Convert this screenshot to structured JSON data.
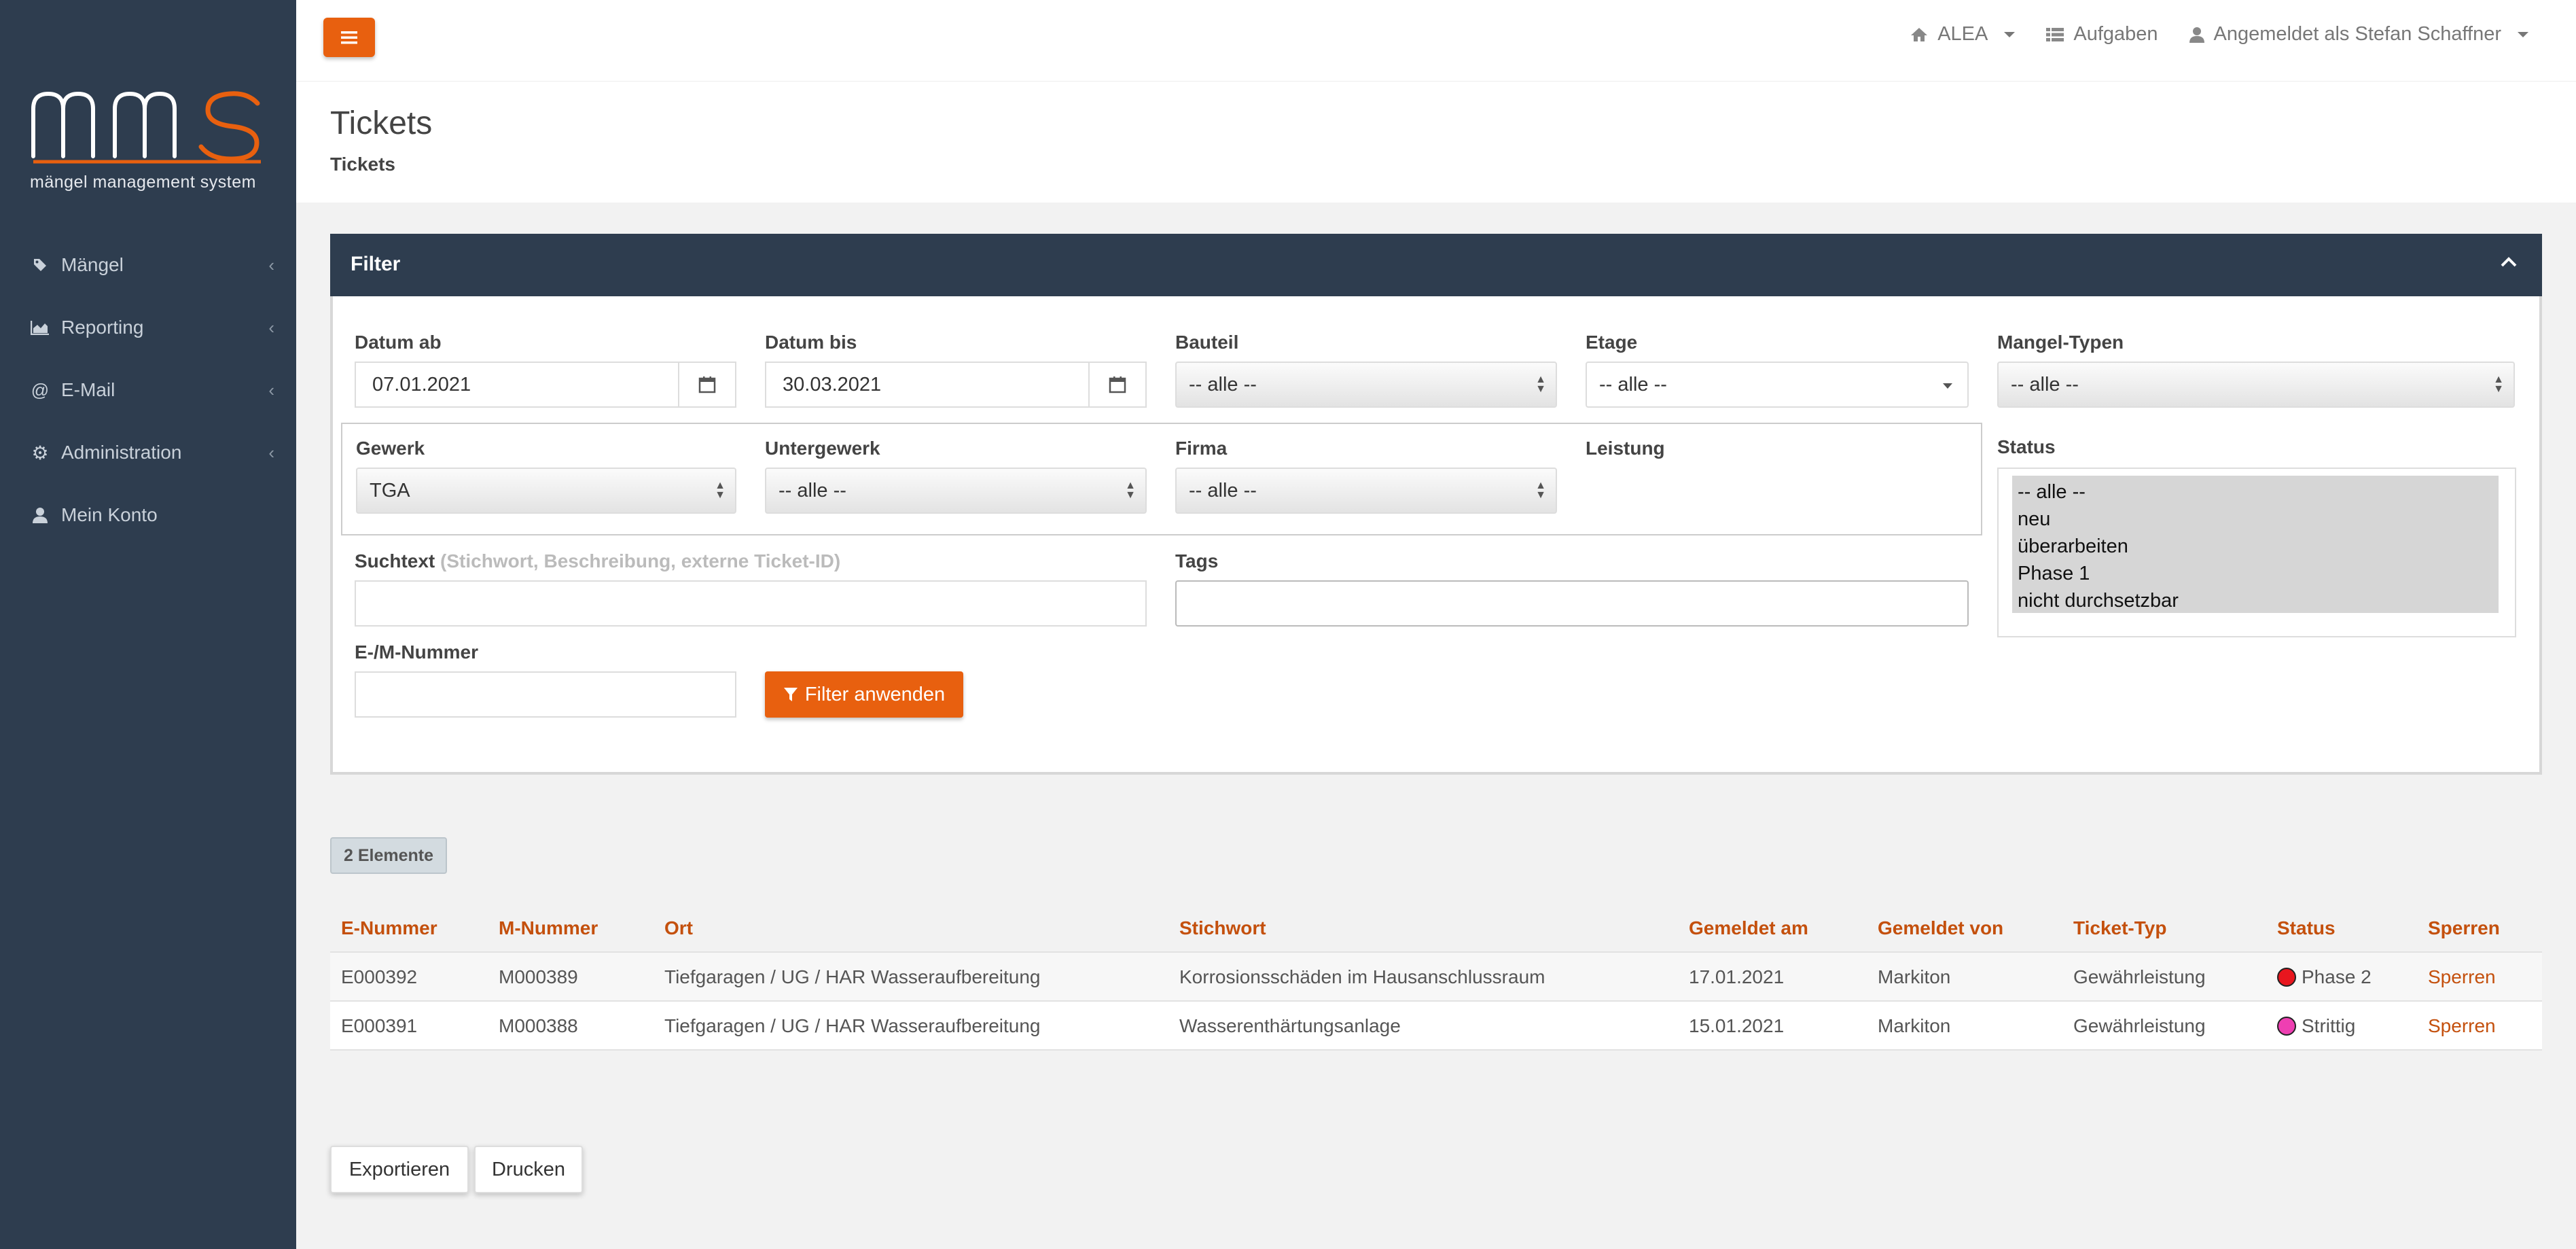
{
  "colors": {
    "accent": "#e8600f",
    "sidebar": "#2e3d4f",
    "header_link": "#c4500d"
  },
  "brand": {
    "subtitle": "mängel management system"
  },
  "sidebar": {
    "items": [
      {
        "label": "Mängel",
        "icon": "tag-icon"
      },
      {
        "label": "Reporting",
        "icon": "area-chart-icon"
      },
      {
        "label": "E-Mail",
        "icon": "at-icon"
      },
      {
        "label": "Administration",
        "icon": "gear-icon"
      },
      {
        "label": "Mein Konto",
        "icon": "user-icon"
      }
    ]
  },
  "topbar": {
    "project": "ALEA",
    "tasks": "Aufgaben",
    "user": "Angemeldet als Stefan Schaffner"
  },
  "page": {
    "title": "Tickets",
    "breadcrumb": "Tickets"
  },
  "filter": {
    "title": "Filter",
    "datum_ab": {
      "label": "Datum ab",
      "value": "07.01.2021"
    },
    "datum_bis": {
      "label": "Datum bis",
      "value": "30.03.2021"
    },
    "bauteil": {
      "label": "Bauteil",
      "value": "-- alle --"
    },
    "etage": {
      "label": "Etage",
      "value": "-- alle --"
    },
    "mangel_typen": {
      "label": "Mangel-Typen",
      "value": "-- alle --"
    },
    "gewerk": {
      "label": "Gewerk",
      "value": "TGA"
    },
    "untergewerk": {
      "label": "Untergewerk",
      "value": "-- alle --"
    },
    "firma": {
      "label": "Firma",
      "value": "-- alle --"
    },
    "leistung": {
      "label": "Leistung"
    },
    "status": {
      "label": "Status",
      "options": [
        "-- alle --",
        "neu",
        "überarbeiten",
        "Phase 1",
        "nicht durchsetzbar"
      ]
    },
    "suchtext": {
      "label": "Suchtext",
      "hint": "(Stichwort, Beschreibung, externe Ticket-ID)",
      "value": ""
    },
    "tags": {
      "label": "Tags",
      "value": ""
    },
    "em_nummer": {
      "label": "E-/M-Nummer",
      "value": ""
    },
    "apply_label": "Filter anwenden"
  },
  "result_count": "2 Elemente",
  "table": {
    "headers": [
      "E-Nummer",
      "M-Nummer",
      "Ort",
      "Stichwort",
      "Gemeldet am",
      "Gemeldet von",
      "Ticket-Typ",
      "Status",
      "Sperren"
    ],
    "rows": [
      {
        "e": "E000392",
        "m": "M000389",
        "ort": "Tiefgaragen / UG / HAR Wasseraufbereitung",
        "stichwort": "Korrosionsschäden im Hausanschlussraum",
        "date": "17.01.2021",
        "von": "Markiton",
        "typ": "Gewährleistung",
        "status": "Phase 2",
        "status_color": "#e8161e",
        "action": "Sperren"
      },
      {
        "e": "E000391",
        "m": "M000388",
        "ort": "Tiefgaragen / UG / HAR Wasseraufbereitung",
        "stichwort": "Wasserenthärtungsanlage",
        "date": "15.01.2021",
        "von": "Markiton",
        "typ": "Gewährleistung",
        "status": "Strittig",
        "status_color": "#ee3fb2",
        "action": "Sperren"
      }
    ]
  },
  "actions": {
    "export": "Exportieren",
    "print": "Drucken"
  }
}
